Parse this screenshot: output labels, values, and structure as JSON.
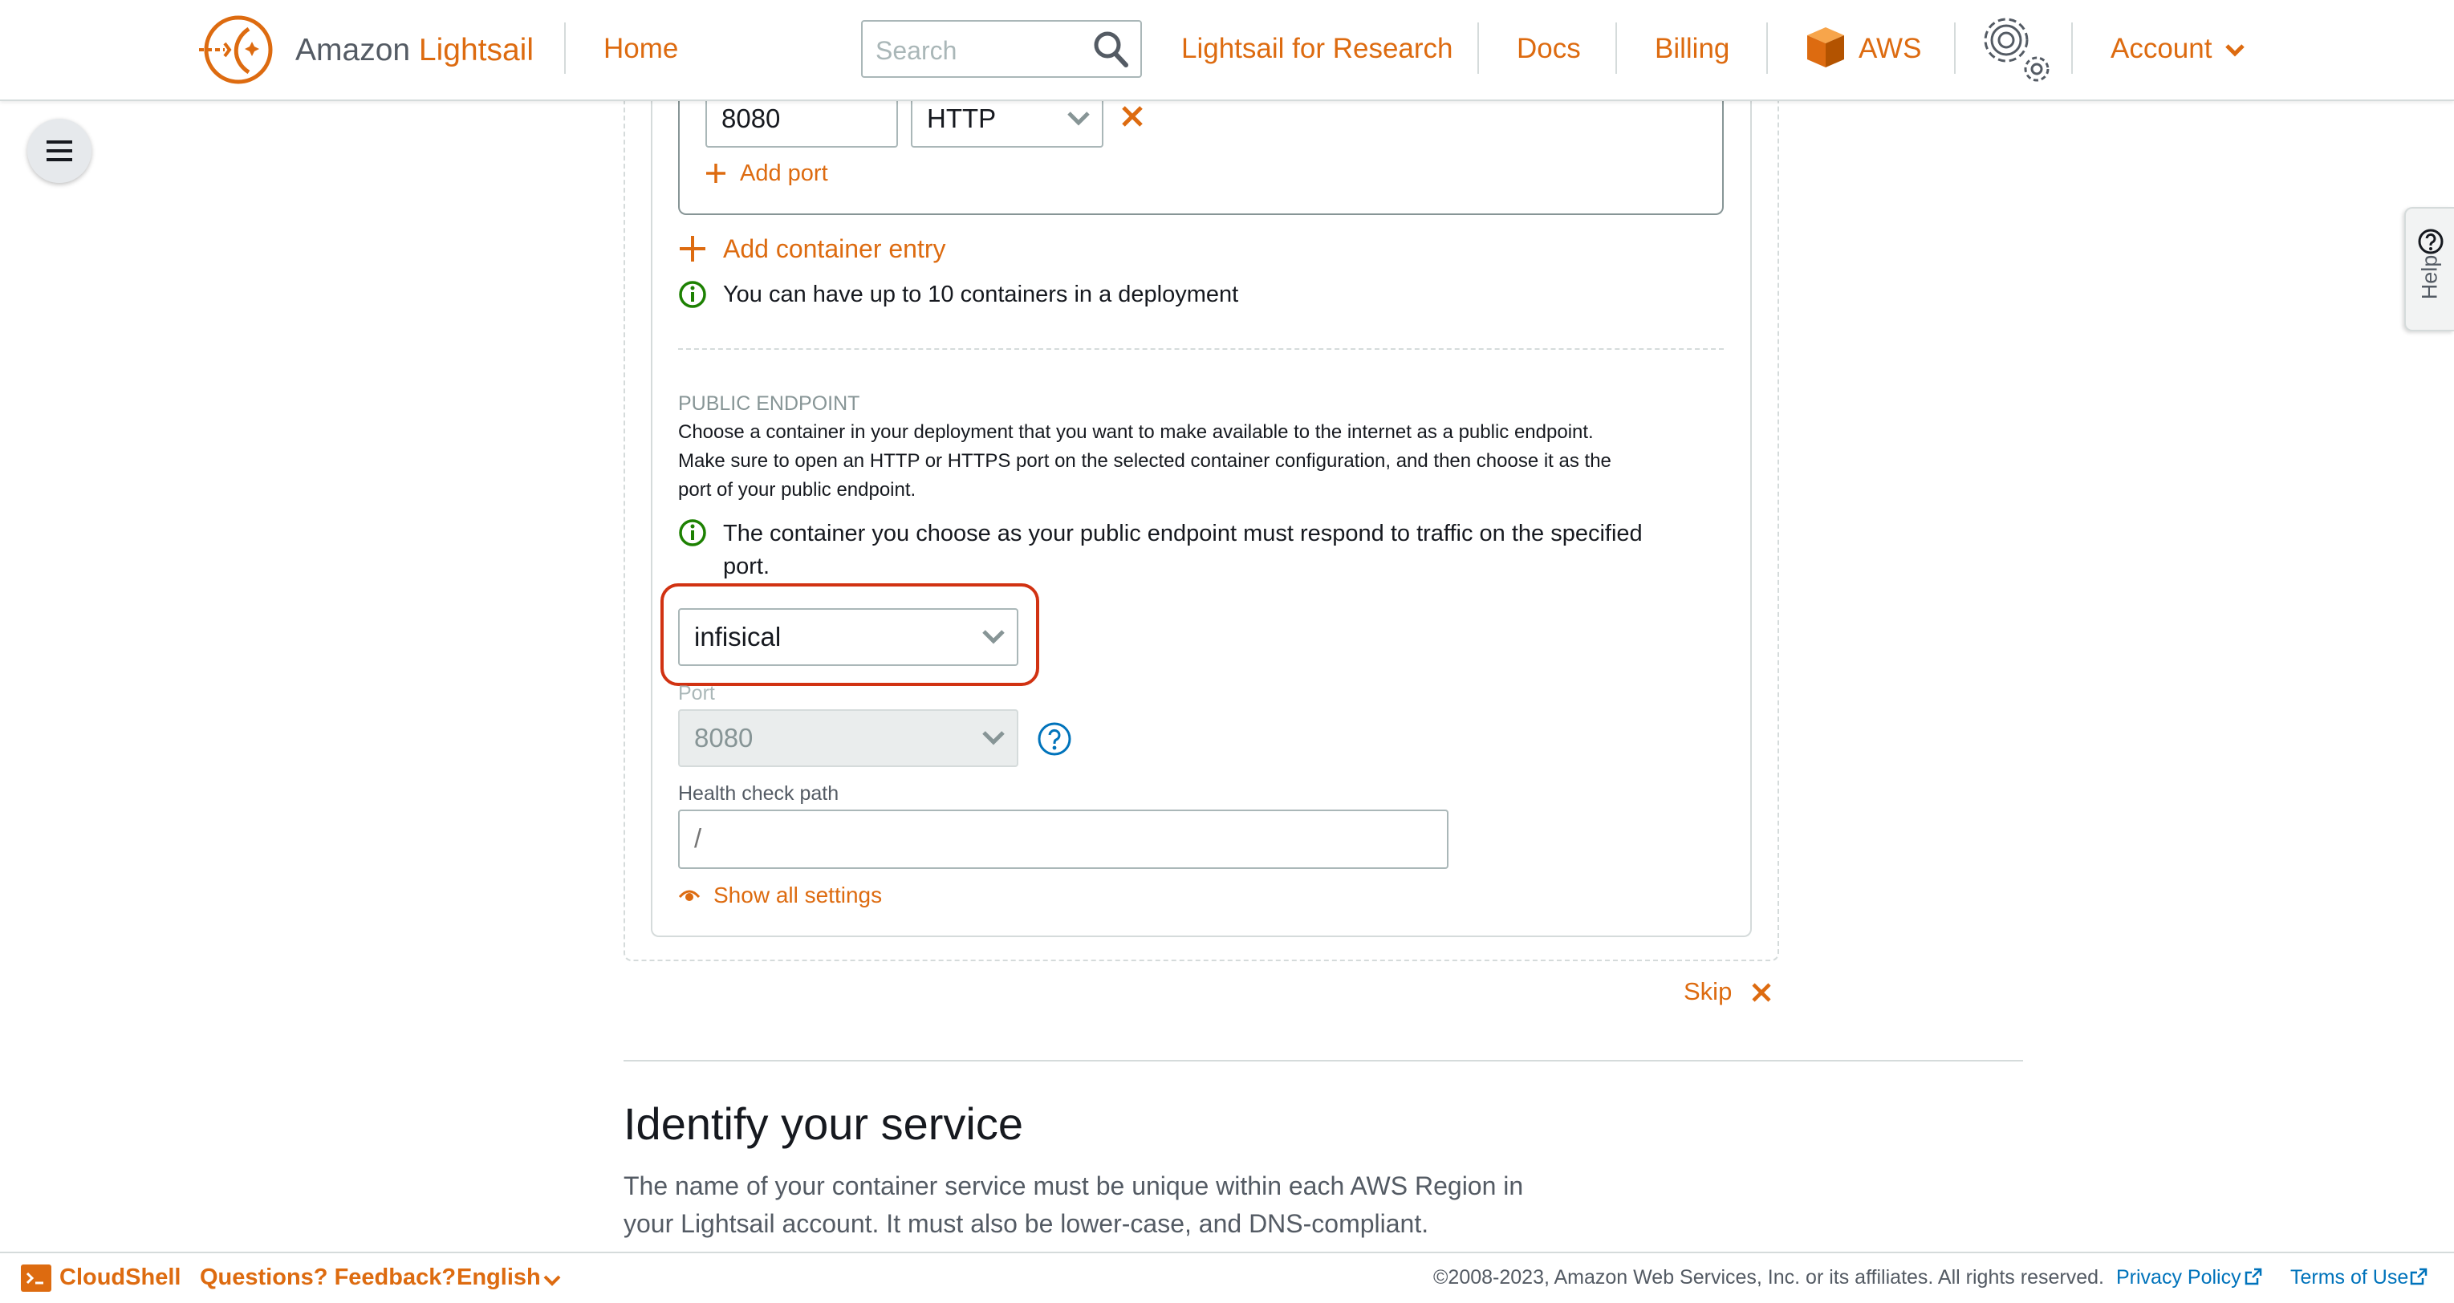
{
  "header": {
    "brand_prefix": "Amazon",
    "brand_name": "Lightsail",
    "nav_home": "Home",
    "search_placeholder": "Search",
    "nav_research": "Lightsail for Research",
    "nav_docs": "Docs",
    "nav_billing": "Billing",
    "nav_aws": "AWS",
    "nav_account": "Account"
  },
  "help_tab": {
    "label": "Help"
  },
  "ports": {
    "port_value": "8080",
    "protocol_value": "HTTP",
    "add_port_label": "Add port"
  },
  "containers": {
    "add_entry_label": "Add container entry",
    "limit_info": "You can have up to 10 containers in a deployment"
  },
  "public_endpoint": {
    "heading": "PUBLIC ENDPOINT",
    "desc_line1": "Choose a container in your deployment that you want to make available to the internet as a public endpoint.",
    "desc_line2": "Make sure to open an HTTP or HTTPS port on the selected container configuration, and then choose it as the",
    "desc_line3": "port of your public endpoint.",
    "info_line1": "The container you choose as your public endpoint must respond to traffic on the specified",
    "info_line2": "port.",
    "container_value": "infisical",
    "port_label": "Port",
    "port_value": "8080",
    "health_label": "Health check path",
    "health_placeholder": "/",
    "show_settings_label": "Show all settings"
  },
  "skip_label": "Skip",
  "identify": {
    "title": "Identify your service",
    "desc_line1": "The name of your container service must be unique within each AWS Region in",
    "desc_line2": "your Lightsail account. It must also be lower-case, and DNS-compliant."
  },
  "footer": {
    "cloudshell": "CloudShell",
    "feedback": "Questions? Feedback?",
    "language": "English",
    "copyright": "©2008-2023, Amazon Web Services, Inc. or its affiliates. All rights reserved.",
    "privacy": "Privacy Policy",
    "terms": "Terms of Use"
  },
  "colors": {
    "accent": "#dd6b10",
    "info_green": "#1d8102",
    "highlight_red": "#d13212",
    "help_blue": "#0073bb"
  }
}
